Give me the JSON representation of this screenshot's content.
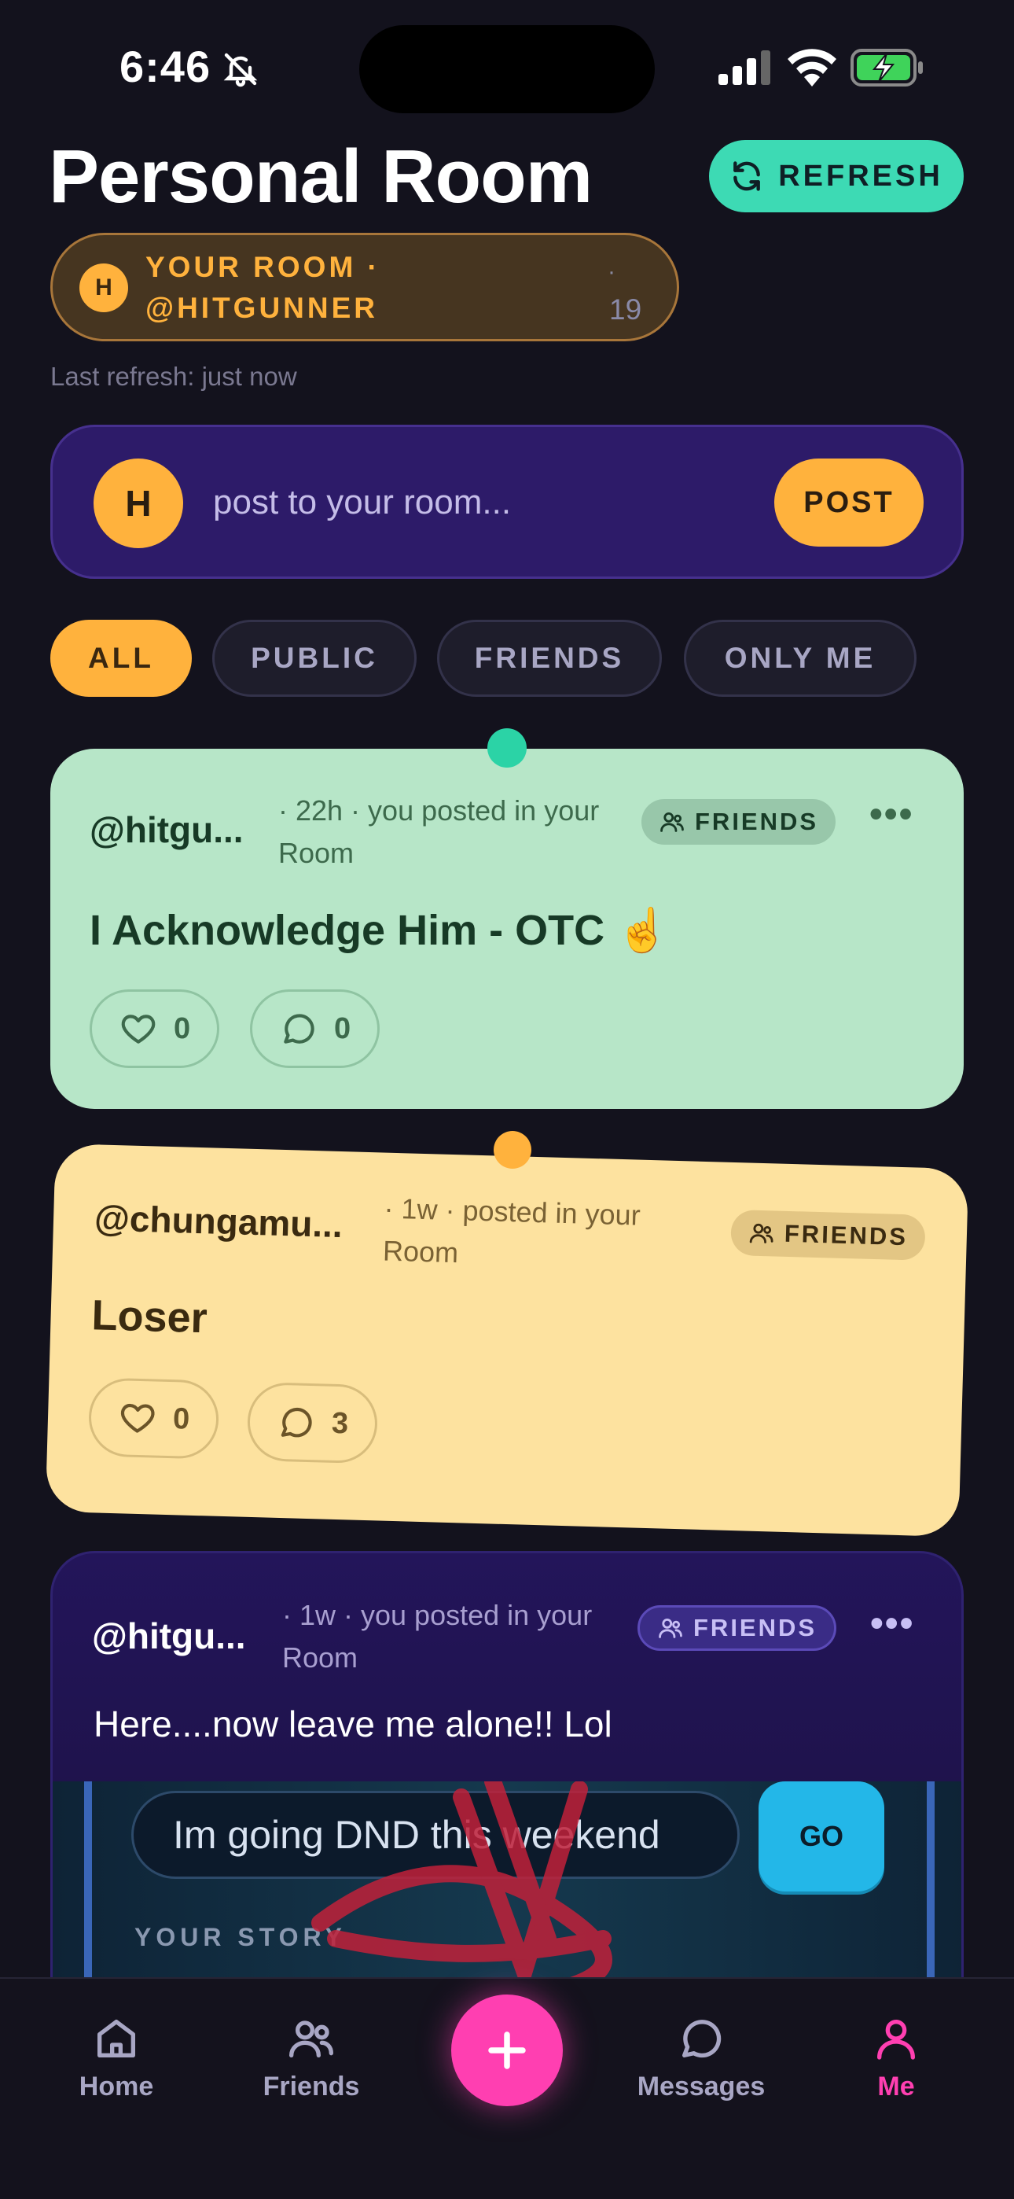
{
  "status_bar": {
    "time": "6:46",
    "icons": [
      "bell-slash-icon",
      "cellular-signal-icon",
      "wifi-icon",
      "battery-charging-icon"
    ]
  },
  "header": {
    "title": "Personal Room",
    "refresh_label": "REFRESH"
  },
  "room": {
    "avatar_initial": "H",
    "line1": "YOUR ROOM ·",
    "line2": "@HITGUNNER",
    "dot": "·",
    "count": "19",
    "last_refresh": "Last refresh: just now"
  },
  "composer": {
    "avatar_initial": "H",
    "placeholder": "post to your room...",
    "post_label": "POST"
  },
  "filters": {
    "tabs": [
      {
        "label": "ALL",
        "active": true
      },
      {
        "label": "PUBLIC",
        "active": false
      },
      {
        "label": "FRIENDS",
        "active": false
      },
      {
        "label": "ONLY ME",
        "active": false
      }
    ]
  },
  "posts": [
    {
      "handle": "@hitgu...",
      "meta_line1": "· 22h · you posted in your",
      "meta_line2": "Room",
      "visibility": "FRIENDS",
      "more": "•••",
      "body": "I Acknowledge Him - OTC ☝️",
      "likes": "0",
      "comments": "0"
    },
    {
      "handle": "@chungamu...",
      "meta_line1": "· 1w · posted in your",
      "meta_line2": "Room",
      "visibility": "FRIENDS",
      "body": "Loser",
      "likes": "0",
      "comments": "3"
    },
    {
      "handle": "@hitgu...",
      "meta_line1": "· 1w · you posted in your",
      "meta_line2": "Room",
      "visibility": "FRIENDS",
      "more": "•••",
      "body": "Here....now leave me alone!! Lol",
      "story_input": "Im going DND this weekend",
      "go_label": "GO",
      "your_story": "YOUR STORY"
    }
  ],
  "nav": {
    "items": [
      {
        "label": "Home",
        "icon": "home-icon"
      },
      {
        "label": "Friends",
        "icon": "friends-icon"
      },
      {
        "label": "Messages",
        "icon": "messages-icon"
      },
      {
        "label": "Me",
        "icon": "profile-icon",
        "active": true
      }
    ]
  },
  "colors": {
    "accent_orange": "#ffb23d",
    "accent_teal": "#3ddab4",
    "accent_pink": "#ff3fb1",
    "background": "#13121d"
  }
}
